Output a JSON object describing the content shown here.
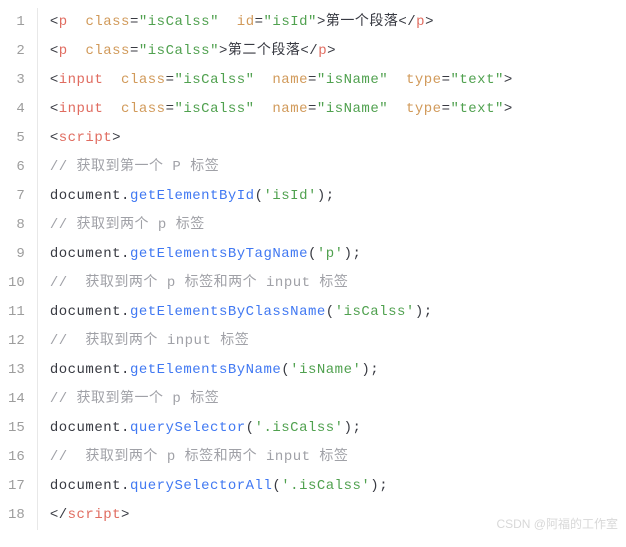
{
  "lines": [
    {
      "num": "1"
    },
    {
      "num": "2"
    },
    {
      "num": "3"
    },
    {
      "num": "4"
    },
    {
      "num": "5"
    },
    {
      "num": "6"
    },
    {
      "num": "7"
    },
    {
      "num": "8"
    },
    {
      "num": "9"
    },
    {
      "num": "10"
    },
    {
      "num": "11"
    },
    {
      "num": "12"
    },
    {
      "num": "13"
    },
    {
      "num": "14"
    },
    {
      "num": "15"
    },
    {
      "num": "16"
    },
    {
      "num": "17"
    },
    {
      "num": "18"
    }
  ],
  "tokens": {
    "lt": "<",
    "gt": ">",
    "lts": "</",
    "p": "p",
    "input": "input",
    "script": "script",
    "class": "class",
    "id": "id",
    "name": "name",
    "type": "type",
    "eq": "=",
    "isCalss": "\"isCalss\"",
    "isId": "\"isId\"",
    "isName": "\"isName\"",
    "text": "\"text\"",
    "para1": "第一个段落",
    "para2": "第二个段落",
    "c1": "// 获取到第一个 P 标签",
    "c2": "// 获取到两个 p 标签",
    "c3": "//  获取到两个 p 标签和两个 input 标签",
    "c4": "//  获取到两个 input 标签",
    "c5": "// 获取到第一个 p 标签",
    "c6": "//  获取到两个 p 标签和两个 input 标签",
    "doc": "document",
    "dot": ".",
    "lp": "(",
    "rp": ")",
    "semi": ";",
    "m1": "getElementById",
    "m2": "getElementsByTagName",
    "m3": "getElementsByClassName",
    "m4": "getElementsByName",
    "m5": "querySelector",
    "m6": "querySelectorAll",
    "s1": "'isId'",
    "s2": "'p'",
    "s3": "'isCalss'",
    "s4": "'isName'",
    "s5": "'.isCalss'",
    "s6": "'.isCalss'"
  },
  "watermark": "CSDN @阿福的工作室"
}
